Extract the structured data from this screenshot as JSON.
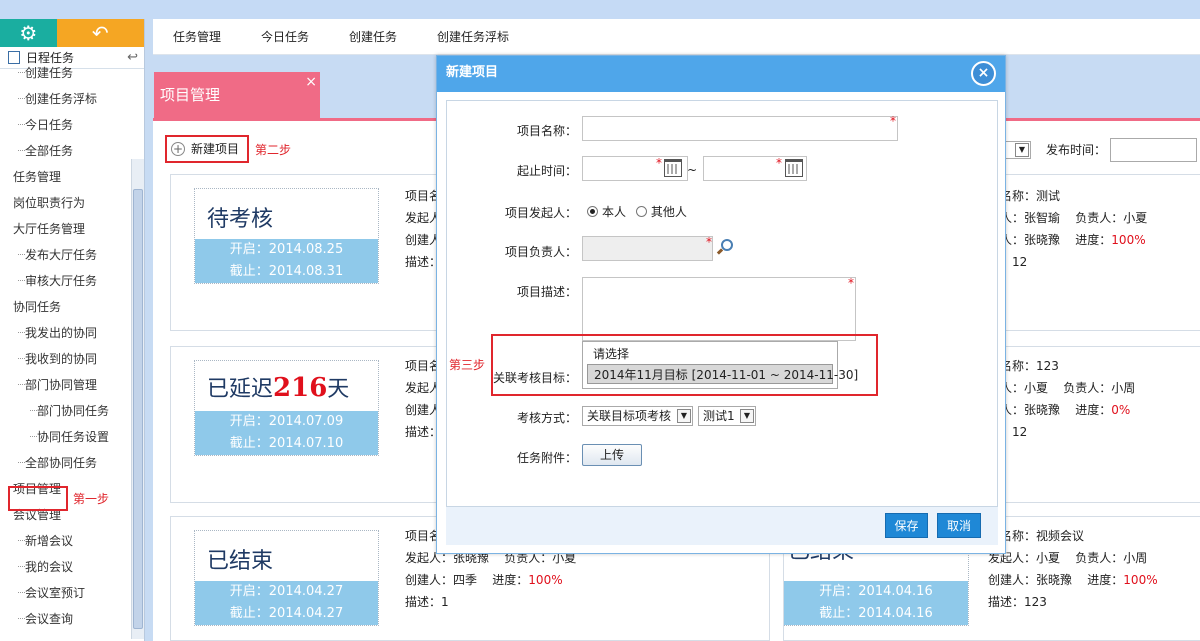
{
  "sidebar": {
    "section_title": "日程任务",
    "items": [
      {
        "label": "创建任务",
        "level": 2
      },
      {
        "label": "创建任务浮标",
        "level": 2
      },
      {
        "label": "今日任务",
        "level": 2
      },
      {
        "label": "全部任务",
        "level": 2
      },
      {
        "label": "任务管理",
        "level": 1
      },
      {
        "label": "岗位职责行为",
        "level": 1
      },
      {
        "label": "大厅任务管理",
        "level": 1
      },
      {
        "label": "发布大厅任务",
        "level": 2
      },
      {
        "label": "审核大厅任务",
        "level": 2
      },
      {
        "label": "协同任务",
        "level": 1
      },
      {
        "label": "我发出的协同",
        "level": 2
      },
      {
        "label": "我收到的协同",
        "level": 2
      },
      {
        "label": "部门协同管理",
        "level": 2
      },
      {
        "label": "部门协同任务",
        "level": 3
      },
      {
        "label": "协同任务设置",
        "level": 3
      },
      {
        "label": "全部协同任务",
        "level": 2
      },
      {
        "label": "项目管理",
        "level": 1
      },
      {
        "label": "会议管理",
        "level": 1
      },
      {
        "label": "新增会议",
        "level": 2
      },
      {
        "label": "我的会议",
        "level": 2
      },
      {
        "label": "会议室预订",
        "level": 2
      },
      {
        "label": "会议查询",
        "level": 2
      }
    ],
    "step1_note": "第一步"
  },
  "topnav": [
    "任务管理",
    "今日任务",
    "创建任务",
    "创建任务浮标"
  ],
  "tab": {
    "label": "项目管理",
    "close": "×"
  },
  "toolbar": {
    "new_project": "新建项目",
    "step2_note": "第二步",
    "publish_time_label": "发布时间："
  },
  "cards": [
    {
      "status": "待考核",
      "start": "开启：2014.08.25",
      "end": "截止：2014.08.31",
      "lines": [
        "项目名",
        "发起人",
        "创建人",
        "描述："
      ]
    },
    {
      "status_prefix": "已延迟",
      "status_num": "216",
      "status_suffix": "天",
      "start": "开启：2014.07.09",
      "end": "截止：2014.07.10",
      "lines": [
        "项目名",
        "发起人",
        "创建人",
        "描述："
      ]
    },
    {
      "status": "已结束",
      "start": "开启：2014.04.27",
      "end": "截止：2014.04.27",
      "line0": "项目名",
      "line1a": "发起人：张晓豫",
      "line1b": "负责人：小夏",
      "line2a": "创建人：四季",
      "line2b": "进度：",
      "line2c": "100%",
      "line3a": "描述：",
      "line3b": "1"
    }
  ],
  "right_cards": [
    {
      "name": "目名称：测试",
      "a": "起人：张智瑜",
      "b": "负责人：小夏",
      "c": "建人：张晓豫",
      "d": "进度：",
      "e": "100%",
      "f": "述：12"
    },
    {
      "name": "目名称：123",
      "a": "起人：小夏",
      "b": "负责人：小周",
      "c": "建人：张晓豫",
      "d": "进度：",
      "e": "0%",
      "f": "述：12"
    },
    {
      "name": "目名称：视频会议",
      "a": "发起人：小夏",
      "b": "负责人：小周",
      "c": "创建人：张晓豫",
      "d": "进度：",
      "e": "100%",
      "f": "描述：123",
      "status": "已结束",
      "start": "开启：2014.04.16",
      "end": "截止：2014.04.16"
    }
  ],
  "modal": {
    "title": "新建项目",
    "close": "×",
    "fields": {
      "name": "项目名称：",
      "period": "起止时间：",
      "period_sep": "~",
      "initiator": "项目发起人：",
      "initiator_self": "本人",
      "initiator_other": "其他人",
      "owner": "项目负责人：",
      "desc": "项目描述：",
      "target": "关联考核目标：",
      "method": "考核方式：",
      "attachment": "任务附件："
    },
    "star": "*",
    "dropdown": {
      "placeholder": "请选择",
      "selected": "2014年11月目标 [2014-11-01 ~ 2014-11-30]"
    },
    "step3_note": "第三步",
    "method_select": "关联目标项考核",
    "method_select2": "测试1",
    "upload": "上传",
    "save": "保存",
    "cancel": "取消"
  }
}
